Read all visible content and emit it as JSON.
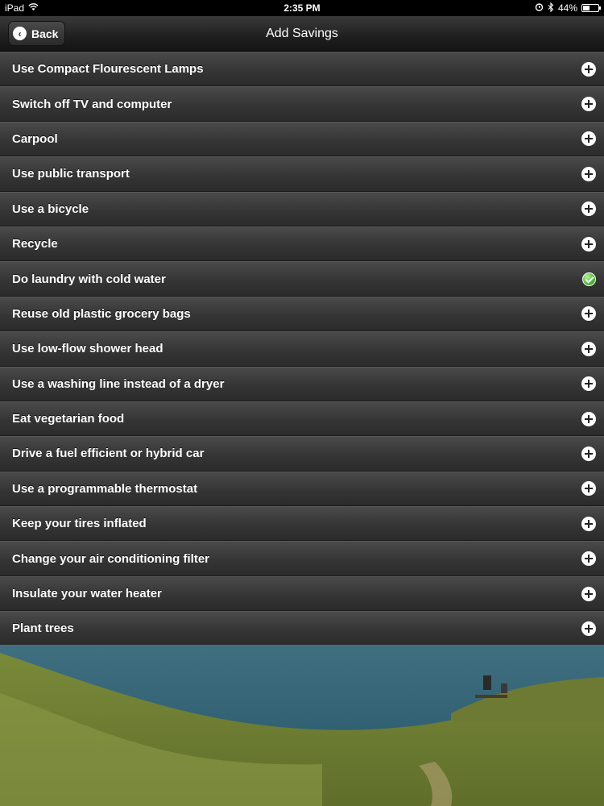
{
  "status": {
    "device": "iPad",
    "time": "2:35 PM",
    "battery_text": "44%",
    "battery_level": 0.44
  },
  "nav": {
    "back_label": "Back",
    "title": "Add Savings"
  },
  "items": [
    {
      "label": "Use Compact Flourescent Lamps",
      "state": "add"
    },
    {
      "label": "Switch off TV and computer",
      "state": "add"
    },
    {
      "label": "Carpool",
      "state": "add"
    },
    {
      "label": "Use public transport",
      "state": "add"
    },
    {
      "label": "Use a bicycle",
      "state": "add"
    },
    {
      "label": "Recycle",
      "state": "add"
    },
    {
      "label": "Do laundry with cold water",
      "state": "added"
    },
    {
      "label": "Reuse old plastic grocery bags",
      "state": "add"
    },
    {
      "label": "Use low-flow shower head",
      "state": "add"
    },
    {
      "label": "Use a washing line instead of a dryer",
      "state": "add"
    },
    {
      "label": "Eat vegetarian food",
      "state": "add"
    },
    {
      "label": "Drive a fuel efficient or hybrid car",
      "state": "add"
    },
    {
      "label": "Use a programmable thermostat",
      "state": "add"
    },
    {
      "label": "Keep your tires inflated",
      "state": "add"
    },
    {
      "label": "Change your air conditioning filter",
      "state": "add"
    },
    {
      "label": "Insulate your water heater",
      "state": "add"
    },
    {
      "label": "Plant trees",
      "state": "add"
    }
  ],
  "icons": {
    "add": "plus-circle-icon",
    "added": "green-check-icon"
  },
  "colors": {
    "added_accent": "#4cb534"
  }
}
